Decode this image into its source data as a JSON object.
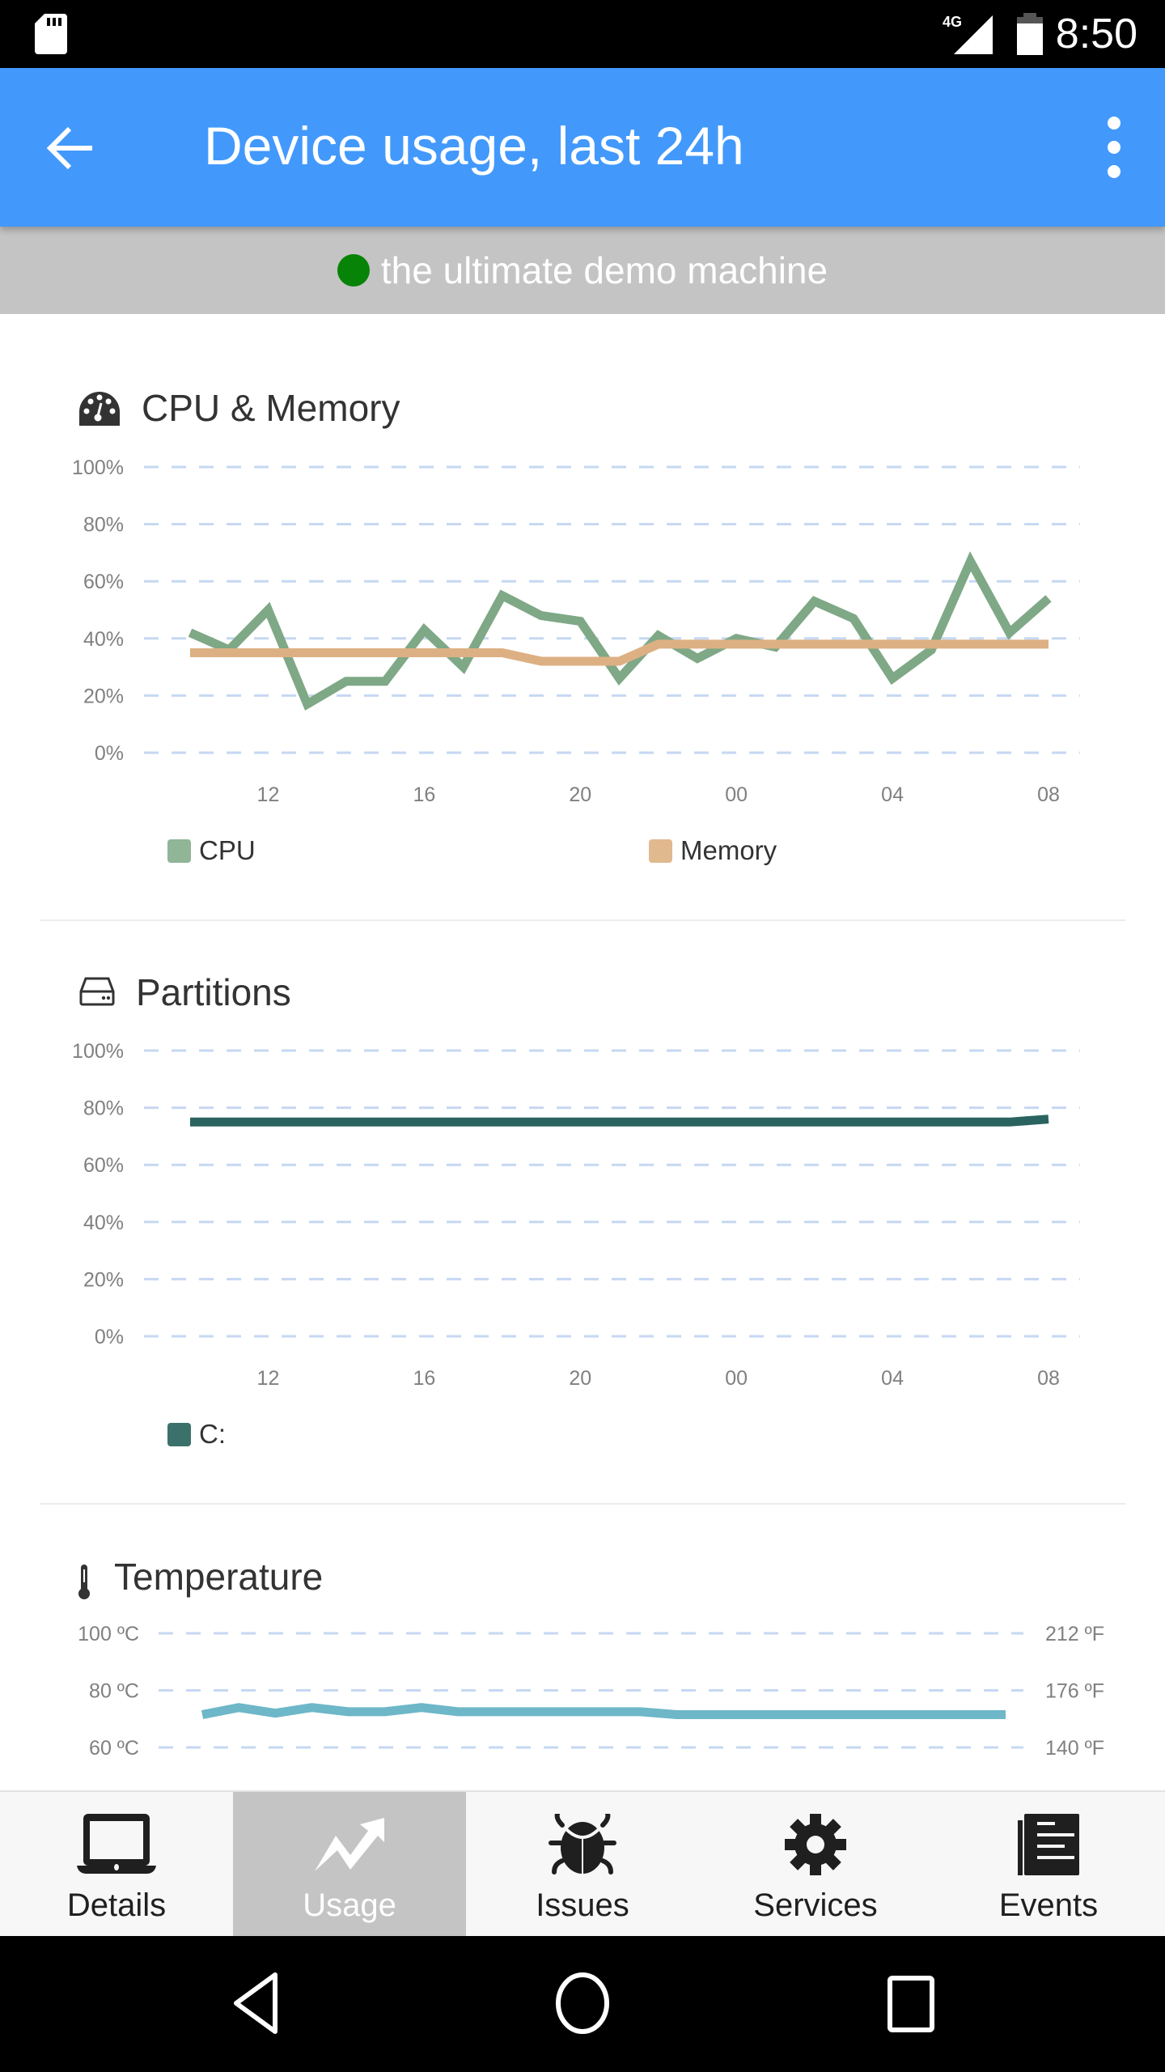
{
  "status_bar": {
    "time": "8:50",
    "network": "4G",
    "icons": [
      "sd-card-icon",
      "signal-4g-icon",
      "battery-icon"
    ]
  },
  "app_bar": {
    "title": "Device usage, last 24h",
    "back_icon": "arrow-back-icon",
    "menu_icon": "more-vert-icon"
  },
  "device": {
    "name": "the ultimate demo machine",
    "status_color": "#078307",
    "status": "online"
  },
  "colors": {
    "app_bar": "#4299fb",
    "cpu": "#7fa886",
    "memory": "#ddb083",
    "partition_c": "#2a6360",
    "temperature": "#6db7c8",
    "grid": "#c6d8f2"
  },
  "sections": {
    "cpu": {
      "title": "CPU & Memory",
      "icon": "dashboard-gauge-icon"
    },
    "partitions": {
      "title": "Partitions",
      "icon": "hard-drive-icon"
    },
    "temperature": {
      "title": "Temperature",
      "icon": "thermometer-icon"
    }
  },
  "chart_data": [
    {
      "id": "cpu-memory",
      "type": "line",
      "title": "CPU & Memory",
      "xlabel": "",
      "ylabel": "",
      "x": [
        "10",
        "11",
        "12",
        "13",
        "14",
        "15",
        "16",
        "17",
        "18",
        "19",
        "20",
        "21",
        "22",
        "23",
        "00",
        "01",
        "02",
        "03",
        "04",
        "05",
        "06",
        "07",
        "08"
      ],
      "x_ticks": [
        "12",
        "16",
        "20",
        "00",
        "04",
        "08"
      ],
      "y_ticks": [
        "0%",
        "20%",
        "40%",
        "60%",
        "80%",
        "100%"
      ],
      "ylim": [
        0,
        100
      ],
      "grid": true,
      "legend_position": "bottom",
      "series": [
        {
          "name": "CPU",
          "color": "#7fa886",
          "values": [
            42,
            36,
            50,
            17,
            25,
            25,
            43,
            30,
            55,
            48,
            46,
            26,
            41,
            33,
            40,
            37,
            53,
            47,
            26,
            36,
            67,
            42,
            54
          ]
        },
        {
          "name": "Memory",
          "color": "#ddb083",
          "values": [
            35,
            35,
            35,
            35,
            35,
            35,
            35,
            35,
            35,
            32,
            32,
            32,
            38,
            38,
            38,
            38,
            38,
            38,
            38,
            38,
            38,
            38,
            38
          ]
        }
      ]
    },
    {
      "id": "partitions",
      "type": "line",
      "title": "Partitions",
      "xlabel": "",
      "ylabel": "",
      "x": [
        "10",
        "11",
        "12",
        "13",
        "14",
        "15",
        "16",
        "17",
        "18",
        "19",
        "20",
        "21",
        "22",
        "23",
        "00",
        "01",
        "02",
        "03",
        "04",
        "05",
        "06",
        "07",
        "08"
      ],
      "x_ticks": [
        "12",
        "16",
        "20",
        "00",
        "04",
        "08"
      ],
      "y_ticks": [
        "0%",
        "20%",
        "40%",
        "60%",
        "80%",
        "100%"
      ],
      "ylim": [
        0,
        100
      ],
      "grid": true,
      "legend_position": "bottom",
      "series": [
        {
          "name": "C:",
          "color": "#2a6360",
          "values": [
            75,
            75,
            75,
            75,
            75,
            75,
            75,
            75,
            75,
            75,
            75,
            75,
            75,
            75,
            75,
            75,
            75,
            75,
            75,
            75,
            75,
            75,
            76
          ]
        }
      ]
    },
    {
      "id": "temperature",
      "type": "line",
      "title": "Temperature",
      "xlabel": "",
      "ylabel": "",
      "x": [
        "10",
        "11",
        "12",
        "13",
        "14",
        "15",
        "16",
        "17",
        "18",
        "19",
        "20",
        "21",
        "22",
        "23",
        "00",
        "01",
        "02",
        "03",
        "04",
        "05",
        "06",
        "07",
        "08"
      ],
      "y_ticks": [
        "60 ºC",
        "80 ºC",
        "100 ºC"
      ],
      "y2_ticks": [
        "140 ºF",
        "176 ºF",
        "212 ºF"
      ],
      "ylim": [
        60,
        100
      ],
      "grid": true,
      "series": [
        {
          "name": "Temperature",
          "color": "#6db7c8",
          "values": [
            71.5,
            74,
            72,
            74,
            72.5,
            72.5,
            74,
            72.5,
            72.5,
            72.5,
            72.5,
            72.5,
            72.5,
            71.5,
            71.5,
            71.5,
            71.5,
            71.5,
            71.5,
            71.5,
            71.5,
            71.5,
            71.5
          ]
        }
      ]
    }
  ],
  "bottom_nav": {
    "tabs": [
      {
        "label": "Details",
        "icon": "laptop-icon",
        "active": false
      },
      {
        "label": "Usage",
        "icon": "trending-up-icon",
        "active": true
      },
      {
        "label": "Issues",
        "icon": "bug-icon",
        "active": false
      },
      {
        "label": "Services",
        "icon": "gear-icon",
        "active": false
      },
      {
        "label": "Events",
        "icon": "document-list-icon",
        "active": false
      }
    ]
  },
  "system_nav": {
    "buttons": [
      "back-triangle-icon",
      "home-circle-icon",
      "recents-square-icon"
    ]
  }
}
